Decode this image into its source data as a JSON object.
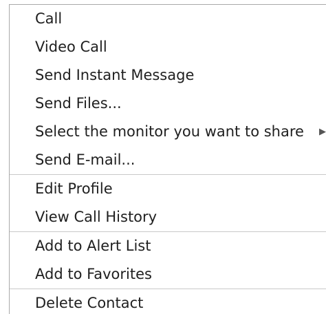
{
  "menu": {
    "items": [
      {
        "label": "Call"
      },
      {
        "label": "Video Call"
      },
      {
        "label": "Send Instant Message"
      },
      {
        "label": "Send Files..."
      },
      {
        "label": "Select the monitor you want to share",
        "submenu_icon": "triangle-right-icon"
      },
      {
        "label": "Send E-mail..."
      },
      {
        "label": "Edit Profile"
      },
      {
        "label": "View Call History"
      },
      {
        "label": "Add to Alert List"
      },
      {
        "label": "Add to Favorites"
      },
      {
        "label": "Delete Contact"
      }
    ]
  }
}
